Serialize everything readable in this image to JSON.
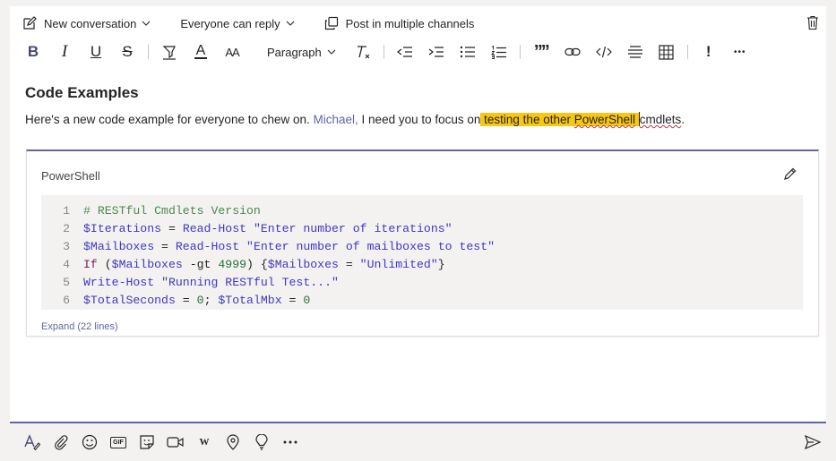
{
  "toolbar_top": {
    "new_conversation": "New conversation",
    "reply_setting": "Everyone can reply",
    "post_multiple": "Post in multiple channels"
  },
  "format": {
    "bold": "B",
    "italic": "I",
    "underline": "U",
    "strike": "S",
    "font_color": "A",
    "font_size": "AA",
    "paragraph": "Paragraph",
    "quote": "””",
    "important": "!",
    "more": "•••"
  },
  "message": {
    "heading": "Code Examples",
    "text_before": "Here's a new code example for everyone to chew on. ",
    "mention": "Michael,",
    "text_middle": " I need you to focus on",
    "highlight_pre": " testing the other ",
    "highlight_word": "PowerShell",
    "text_after_word": "cmdlets",
    "text_end": "."
  },
  "code_block": {
    "language": "PowerShell",
    "expand_label": "Expand (22 lines)",
    "lines": [
      {
        "n": "1",
        "parts": [
          [
            "c-comment",
            "# RESTful Cmdlets Version"
          ]
        ]
      },
      {
        "n": "2",
        "parts": [
          [
            "c-var",
            "$Iterations"
          ],
          [
            "c-plain",
            " = "
          ],
          [
            "c-cmd",
            "Read-Host"
          ],
          [
            "c-plain",
            " "
          ],
          [
            "c-str",
            "\"Enter number of iterations\""
          ]
        ]
      },
      {
        "n": "3",
        "parts": [
          [
            "c-var",
            "$Mailboxes"
          ],
          [
            "c-plain",
            " = "
          ],
          [
            "c-cmd",
            "Read-Host"
          ],
          [
            "c-plain",
            " "
          ],
          [
            "c-str",
            "\"Enter number of mailboxes to test\""
          ]
        ]
      },
      {
        "n": "4",
        "parts": [
          [
            "c-kw",
            "If"
          ],
          [
            "c-plain",
            " ("
          ],
          [
            "c-var",
            "$Mailboxes"
          ],
          [
            "c-plain",
            " -gt "
          ],
          [
            "c-num",
            "4999"
          ],
          [
            "c-plain",
            ") {"
          ],
          [
            "c-var",
            "$Mailboxes"
          ],
          [
            "c-plain",
            " = "
          ],
          [
            "c-str",
            "\"Unlimited\""
          ],
          [
            "c-plain",
            "}"
          ]
        ]
      },
      {
        "n": "5",
        "parts": [
          [
            "c-cmd",
            "Write-Host"
          ],
          [
            "c-plain",
            " "
          ],
          [
            "c-str",
            "\"Running RESTful Test...\""
          ]
        ]
      },
      {
        "n": "6",
        "parts": [
          [
            "c-var",
            "$TotalSeconds"
          ],
          [
            "c-plain",
            " = "
          ],
          [
            "c-num",
            "0"
          ],
          [
            "c-plain",
            "; "
          ],
          [
            "c-var",
            "$TotalMbx"
          ],
          [
            "c-plain",
            " = "
          ],
          [
            "c-num",
            "0"
          ]
        ]
      }
    ]
  },
  "bottom_bar": {
    "gif_label": "GIF",
    "wiki_label": "W"
  },
  "colors": {
    "accent": "#6264a7",
    "highlight": "#f8c711",
    "link": "#6264a7"
  }
}
